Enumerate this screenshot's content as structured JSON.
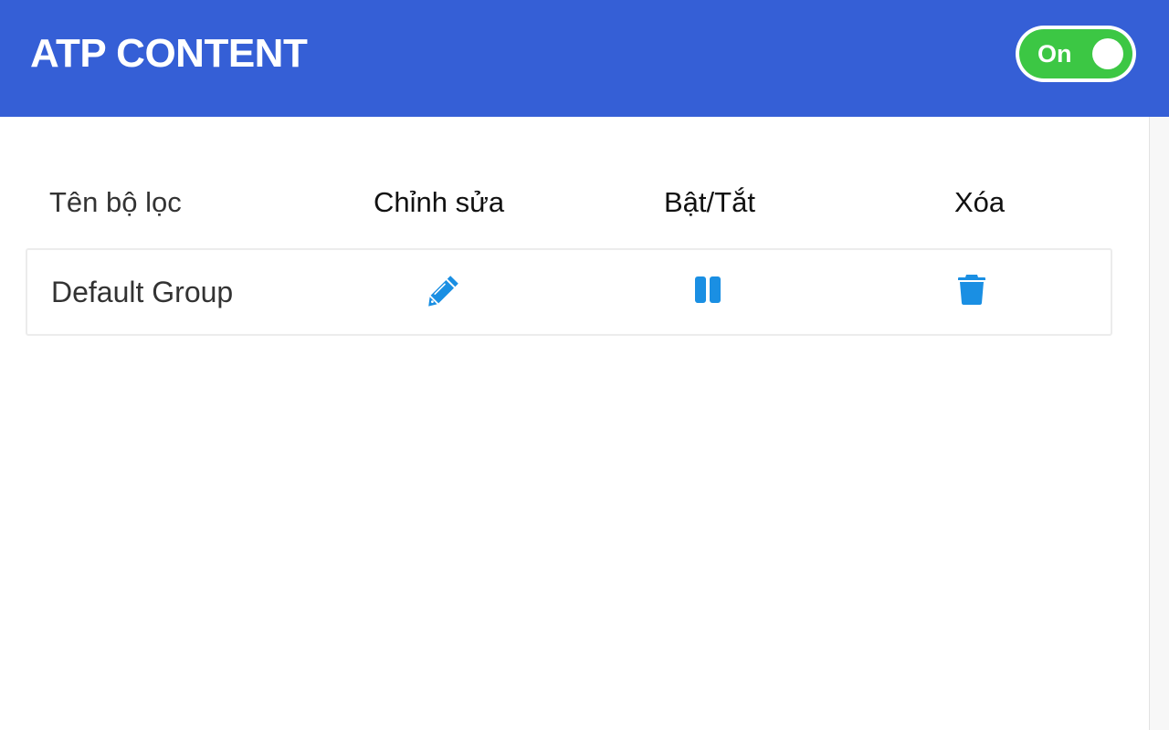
{
  "header": {
    "title": "ATP CONTENT",
    "toggle_label": "On",
    "accent_color": "#355fd6",
    "toggle_color": "#3cc744"
  },
  "table": {
    "columns": [
      "Tên bộ lọc",
      "Chỉnh sửa",
      "Bật/Tắt",
      "Xóa"
    ],
    "rows": [
      {
        "name": "Default Group",
        "edit_icon": "pencil-icon",
        "toggle_icon": "pause-icon",
        "delete_icon": "trash-icon"
      }
    ],
    "icon_color": "#1a8fe3"
  }
}
